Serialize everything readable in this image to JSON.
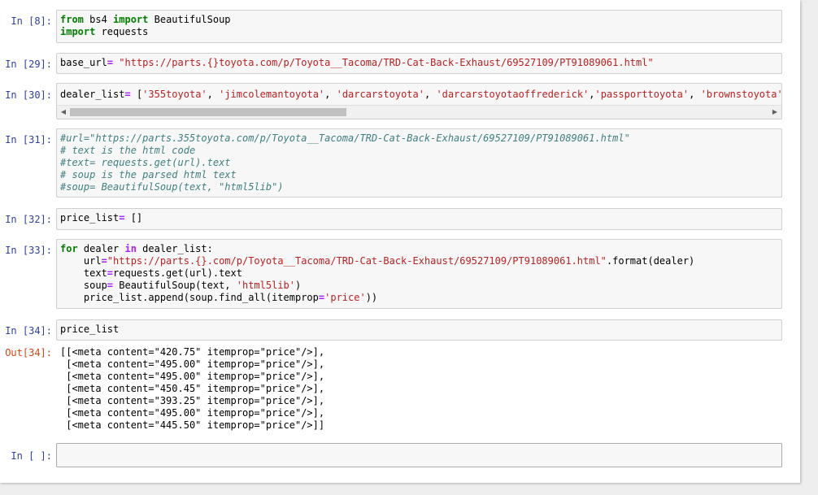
{
  "cells": [
    {
      "prompt": "In [8]:",
      "lines": [
        [
          {
            "t": "kw",
            "v": "from"
          },
          {
            "t": "pl",
            "v": " bs4 "
          },
          {
            "t": "kw",
            "v": "import"
          },
          {
            "t": "pl",
            "v": " BeautifulSoup"
          }
        ],
        [
          {
            "t": "kw",
            "v": "import"
          },
          {
            "t": "pl",
            "v": " requests"
          }
        ]
      ]
    },
    {
      "prompt": "In [29]:",
      "lines": [
        [
          {
            "t": "pl",
            "v": "base_url"
          },
          {
            "t": "op",
            "v": "="
          },
          {
            "t": "pl",
            "v": " "
          },
          {
            "t": "str",
            "v": "\"https://parts.{}toyota.com/p/Toyota__Tacoma/TRD-Cat-Back-Exhaust/69527109/PT91089061.html\""
          }
        ]
      ]
    },
    {
      "prompt": "In [30]:",
      "lines": [
        [
          {
            "t": "pl",
            "v": "dealer_list"
          },
          {
            "t": "op",
            "v": "="
          },
          {
            "t": "pl",
            "v": " ["
          },
          {
            "t": "str",
            "v": "'355toyota'"
          },
          {
            "t": "pl",
            "v": ", "
          },
          {
            "t": "str",
            "v": "'jimcolemantoyota'"
          },
          {
            "t": "pl",
            "v": ", "
          },
          {
            "t": "str",
            "v": "'darcarstoyota'"
          },
          {
            "t": "pl",
            "v": ", "
          },
          {
            "t": "str",
            "v": "'darcarstoyotaoffrederick'"
          },
          {
            "t": "pl",
            "v": ","
          },
          {
            "t": "str",
            "v": "'passporttoyota'"
          },
          {
            "t": "pl",
            "v": ", "
          },
          {
            "t": "str",
            "v": "'brownstoyota'"
          },
          {
            "t": "pl",
            "v": ", "
          },
          {
            "t": "str",
            "v": "'dar"
          }
        ]
      ]
    },
    {
      "prompt": "In [31]:",
      "lines": [
        [
          {
            "t": "cm",
            "v": "#url=\"https://parts.355toyota.com/p/Toyota__Tacoma/TRD-Cat-Back-Exhaust/69527109/PT91089061.html\""
          }
        ],
        [
          {
            "t": "cm",
            "v": "# text is the html code"
          }
        ],
        [
          {
            "t": "cm",
            "v": "#text= requests.get(url).text"
          }
        ],
        [
          {
            "t": "cm",
            "v": "# soup is the parsed html text"
          }
        ],
        [
          {
            "t": "cm",
            "v": "#soup= BeautifulSoup(text, \"html5lib\")"
          }
        ]
      ]
    },
    {
      "prompt": "In [32]:",
      "lines": [
        [
          {
            "t": "pl",
            "v": "price_list"
          },
          {
            "t": "op",
            "v": "="
          },
          {
            "t": "pl",
            "v": " []"
          }
        ]
      ]
    },
    {
      "prompt": "In [33]:",
      "lines": [
        [
          {
            "t": "kw",
            "v": "for"
          },
          {
            "t": "pl",
            "v": " dealer "
          },
          {
            "t": "op",
            "v": "in"
          },
          {
            "t": "pl",
            "v": " dealer_list:"
          }
        ],
        [
          {
            "t": "pl",
            "v": "    url"
          },
          {
            "t": "op",
            "v": "="
          },
          {
            "t": "str",
            "v": "\"https://parts.{}.com/p/Toyota__Tacoma/TRD-Cat-Back-Exhaust/69527109/PT91089061.html\""
          },
          {
            "t": "pl",
            "v": ".format(dealer)"
          }
        ],
        [
          {
            "t": "pl",
            "v": "    text"
          },
          {
            "t": "op",
            "v": "="
          },
          {
            "t": "pl",
            "v": "requests.get(url).text"
          }
        ],
        [
          {
            "t": "pl",
            "v": "    soup"
          },
          {
            "t": "op",
            "v": "="
          },
          {
            "t": "pl",
            "v": " BeautifulSoup(text, "
          },
          {
            "t": "str",
            "v": "'html5lib'"
          },
          {
            "t": "pl",
            "v": ")"
          }
        ],
        [
          {
            "t": "pl",
            "v": "    price_list.append(soup.find_all(itemprop"
          },
          {
            "t": "op",
            "v": "="
          },
          {
            "t": "str",
            "v": "'price'"
          },
          {
            "t": "pl",
            "v": "))"
          }
        ]
      ]
    },
    {
      "prompt": "In [34]:",
      "lines": [
        [
          {
            "t": "pl",
            "v": "price_list"
          }
        ]
      ]
    }
  ],
  "output": {
    "prompt": "Out[34]:",
    "lines": [
      "[[<meta content=\"420.75\" itemprop=\"price\"/>],",
      " [<meta content=\"495.00\" itemprop=\"price\"/>],",
      " [<meta content=\"495.00\" itemprop=\"price\"/>],",
      " [<meta content=\"450.45\" itemprop=\"price\"/>],",
      " [<meta content=\"393.25\" itemprop=\"price\"/>],",
      " [<meta content=\"495.00\" itemprop=\"price\"/>],",
      " [<meta content=\"445.50\" itemprop=\"price\"/>]]"
    ]
  },
  "empty_cell": {
    "prompt": "In [ ]:"
  },
  "scrollbar": {
    "left_icon": "scroll-left-arrow-icon",
    "right_icon": "scroll-right-arrow-icon"
  }
}
